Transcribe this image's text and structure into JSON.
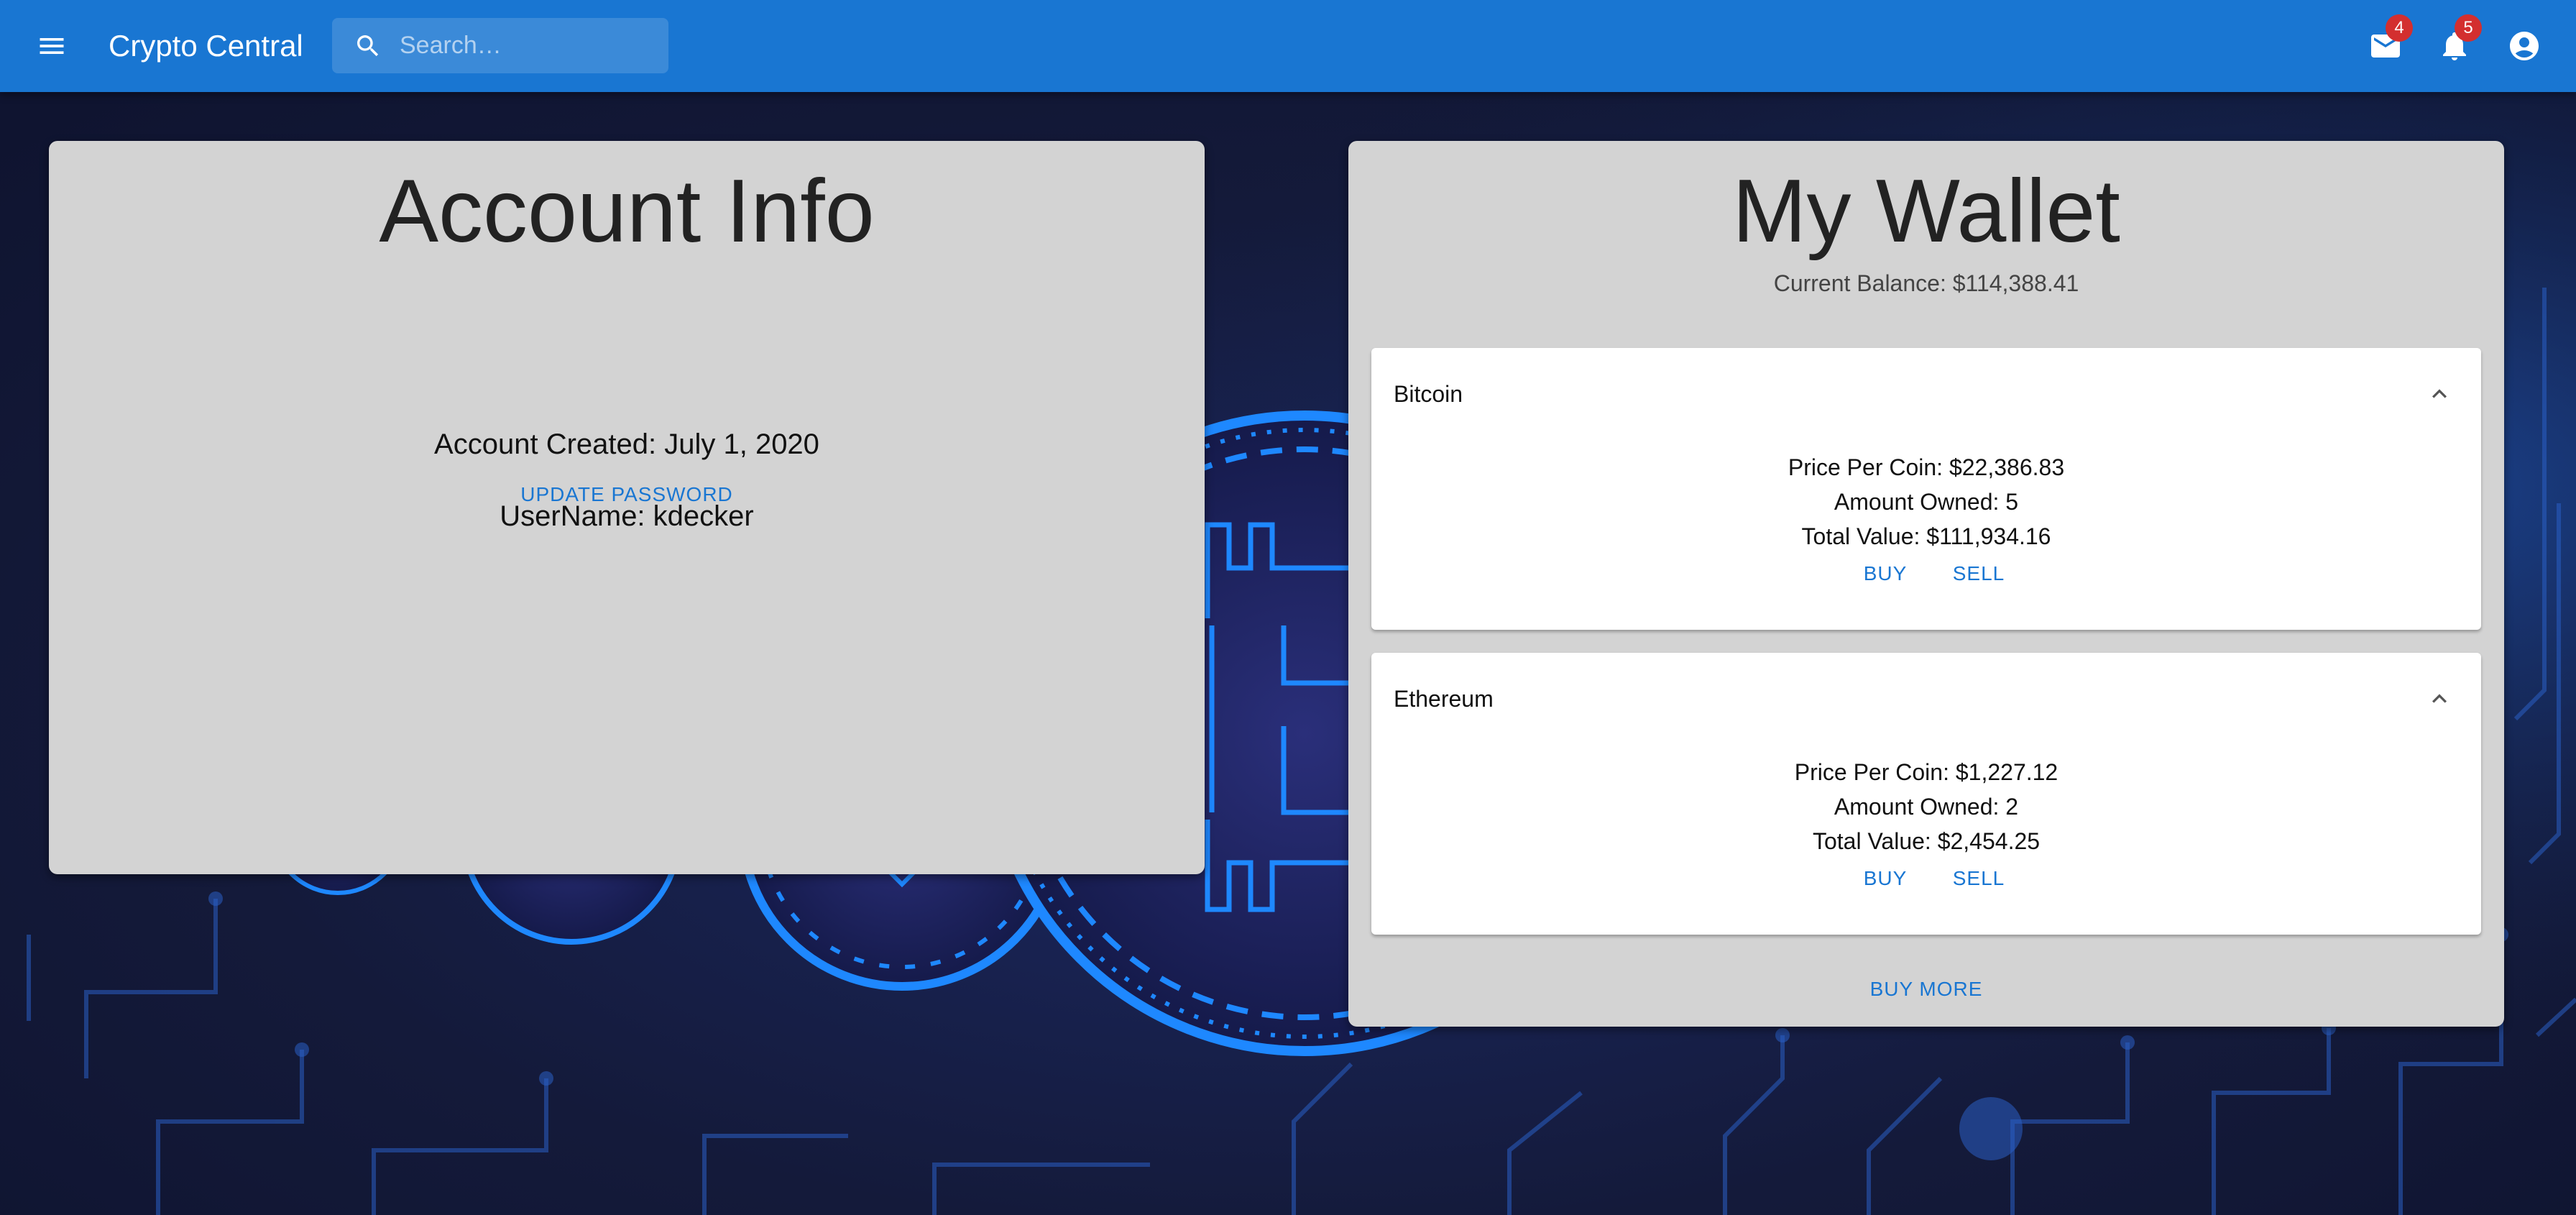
{
  "app": {
    "title": "Crypto Central",
    "search_placeholder": "Search…",
    "mail_count": "4",
    "notification_count": "5"
  },
  "account": {
    "title": "Account Info",
    "created": "Account Created: July 1, 2020",
    "username": "UserName: kdecker",
    "update_password_label": "UPDATE PASSWORD"
  },
  "wallet": {
    "title": "My Wallet",
    "balance": "Current Balance: $114,388.41",
    "coins": [
      {
        "name": "Bitcoin",
        "price": "Price Per Coin: $22,386.83",
        "amount": "Amount Owned: 5",
        "total": "Total Value: $111,934.16",
        "buy_label": "BUY",
        "sell_label": "SELL"
      },
      {
        "name": "Ethereum",
        "price": "Price Per Coin: $1,227.12",
        "amount": "Amount Owned: 2",
        "total": "Total Value: $2,454.25",
        "buy_label": "BUY",
        "sell_label": "SELL"
      }
    ],
    "buy_more_label": "BUY MORE"
  },
  "colors": {
    "primary": "#1976d2",
    "badge": "#d32f2f",
    "card": "#d3d3d3",
    "background": "#141a36",
    "circuit": "#1e88ff"
  },
  "icons": {
    "menu": "menu-icon",
    "search": "search-icon",
    "mail": "mail-icon",
    "bell": "bell-icon",
    "account": "account-circle-icon",
    "chevron": "chevron-up-icon"
  }
}
